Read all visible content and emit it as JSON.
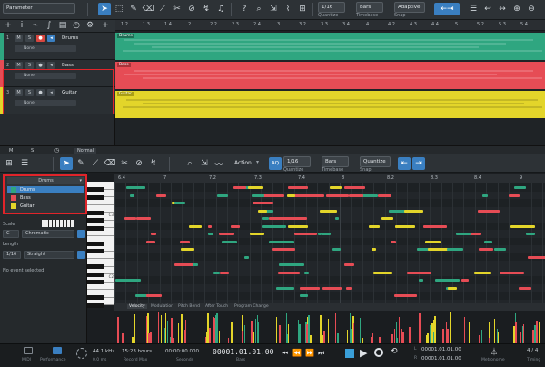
{
  "toolbar": {
    "parameter_label": "Parameter",
    "quantize": {
      "value": "1/16",
      "caption": "Quantize"
    },
    "timebase": {
      "value": "Bars",
      "caption": "Timebase"
    },
    "snap": {
      "value": "Adaptive",
      "caption": "Snap"
    }
  },
  "tracks": [
    {
      "num": "1",
      "name": "Drums",
      "io": "None",
      "color": "#2fa680",
      "event_color": "#2fa680",
      "event_label": "Drums"
    },
    {
      "num": "2",
      "name": "Bass",
      "io": "None",
      "color": "#e64c55",
      "event_color": "#e64c55",
      "event_label": "Bass"
    },
    {
      "num": "3",
      "name": "Guitar",
      "io": "None",
      "color": "#e3d52a",
      "event_color": "#e3d52a",
      "event_label": "Guitar"
    }
  ],
  "track_buttons": {
    "m": "M",
    "s": "S"
  },
  "arrange_ruler": [
    "1.2",
    "1.3",
    "1.4",
    "2",
    "2.2",
    "2.3",
    "2.4",
    "3",
    "3.2",
    "3.3",
    "3.4",
    "4",
    "4.2",
    "4.3",
    "4.4",
    "5",
    "5.2",
    "5.3",
    "5.4"
  ],
  "mid_strip": {
    "m": "M",
    "s": "S",
    "zoom": "Normal"
  },
  "editor_toolbar": {
    "action": "Action",
    "aq": "AQ",
    "quantize": {
      "value": "1/16",
      "caption": "Quantize"
    },
    "timebase": {
      "value": "Bars",
      "caption": "Timebase"
    },
    "snap": {
      "value": "Quantize",
      "caption": "Snap"
    }
  },
  "popup": {
    "header": "Drums",
    "items": [
      {
        "label": "Drums",
        "color": "#2fa680",
        "selected": true
      },
      {
        "label": "Bass",
        "color": "#e64c55",
        "selected": false
      },
      {
        "label": "Guitar",
        "color": "#e3d52a",
        "selected": false
      }
    ]
  },
  "inspector": {
    "scale_label": "Scale",
    "scale_root": "C",
    "scale_type": "Chromatic",
    "length_label": "Length",
    "length_value": "1/16",
    "length_mode": "Straight",
    "status": "No event selected"
  },
  "roll_ruler": [
    "6.4",
    "7",
    "7.2",
    "7.3",
    "7.4",
    "8",
    "8.2",
    "8.3",
    "8.4",
    "9"
  ],
  "piano_labels": [
    "C3",
    "C2"
  ],
  "vel_tabs": [
    "Velocity",
    "Modulation",
    "Pitch Bend",
    "After Touch",
    "Program Change"
  ],
  "transport": {
    "midi": "MIDI",
    "performance": "Performance",
    "sample_rate": "44.1 kHz",
    "latency": "0.0 ms",
    "record_time": "15:23 hours",
    "record_caption": "Record Max",
    "seconds": "00:00:00.000",
    "seconds_caption": "Seconds",
    "bars": "00001.01.01.00",
    "bars_caption": "Bars",
    "loop_l": "00001.01.01.00",
    "loop_r": "00001.01.01.00",
    "loop_l_label": "L",
    "loop_r_label": "R",
    "metronome": "Metronome",
    "timing": "Timing",
    "signature": "4 / 4"
  },
  "colors": {
    "accent": "#3a7fc1",
    "drums": "#2fa680",
    "bass": "#e64c55",
    "guitar": "#e3d52a",
    "highlight": "#e1242a"
  }
}
